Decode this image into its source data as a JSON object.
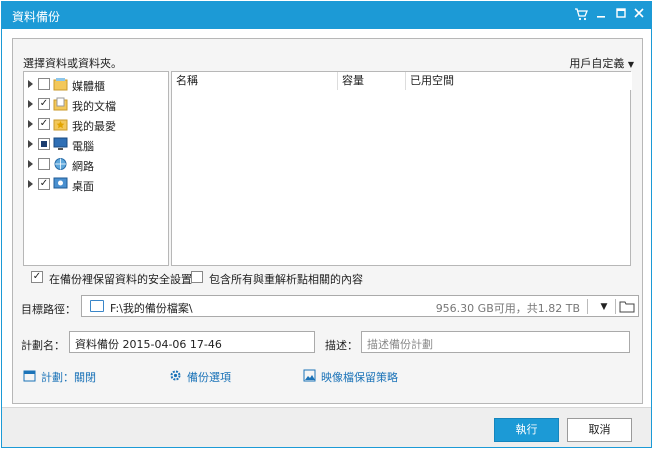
{
  "window": {
    "title": "資料備份",
    "cart_icon": "cart-icon",
    "minimize_icon": "minimize-icon",
    "maximize_icon": "maximize-icon",
    "close_icon": "close-icon"
  },
  "selector": {
    "hint": "選擇資料或資料夾。",
    "filter_label": "用戶自定義"
  },
  "tree": [
    {
      "label": "媒體櫃",
      "checked": "none",
      "icon": "library-icon"
    },
    {
      "label": "我的文檔",
      "checked": "checked",
      "icon": "documents-icon"
    },
    {
      "label": "我的最愛",
      "checked": "checked",
      "icon": "favorites-icon"
    },
    {
      "label": "電腦",
      "checked": "partial",
      "icon": "computer-icon"
    },
    {
      "label": "網路",
      "checked": "none",
      "icon": "network-icon"
    },
    {
      "label": "桌面",
      "checked": "checked",
      "icon": "desktop-icon"
    }
  ],
  "filelist": {
    "columns": [
      "名稱",
      "容量",
      "已用空間"
    ]
  },
  "options": {
    "keep_security": "在備份裡保留資料的安全設置",
    "keep_security_checked": true,
    "include_reparse": "包含所有與重解析點相關的內容",
    "include_reparse_checked": false
  },
  "destination": {
    "label": "目標路徑：",
    "path": "F:\\我的備份檔案\\",
    "space": "956.30 GB可用，共1.82 TB"
  },
  "plan": {
    "name_label": "計劃名：",
    "name_value": "資料備份 2015-04-06 17-46",
    "desc_label": "描述：",
    "desc_placeholder": "描述備份計劃"
  },
  "links": {
    "schedule": "計劃：關閉",
    "backup_options": "備份選項",
    "retention": "映像檔保留策略"
  },
  "footer": {
    "run": "執行",
    "cancel": "取消"
  },
  "colors": {
    "accent": "#1c9ad6",
    "link": "#1b73b8"
  }
}
